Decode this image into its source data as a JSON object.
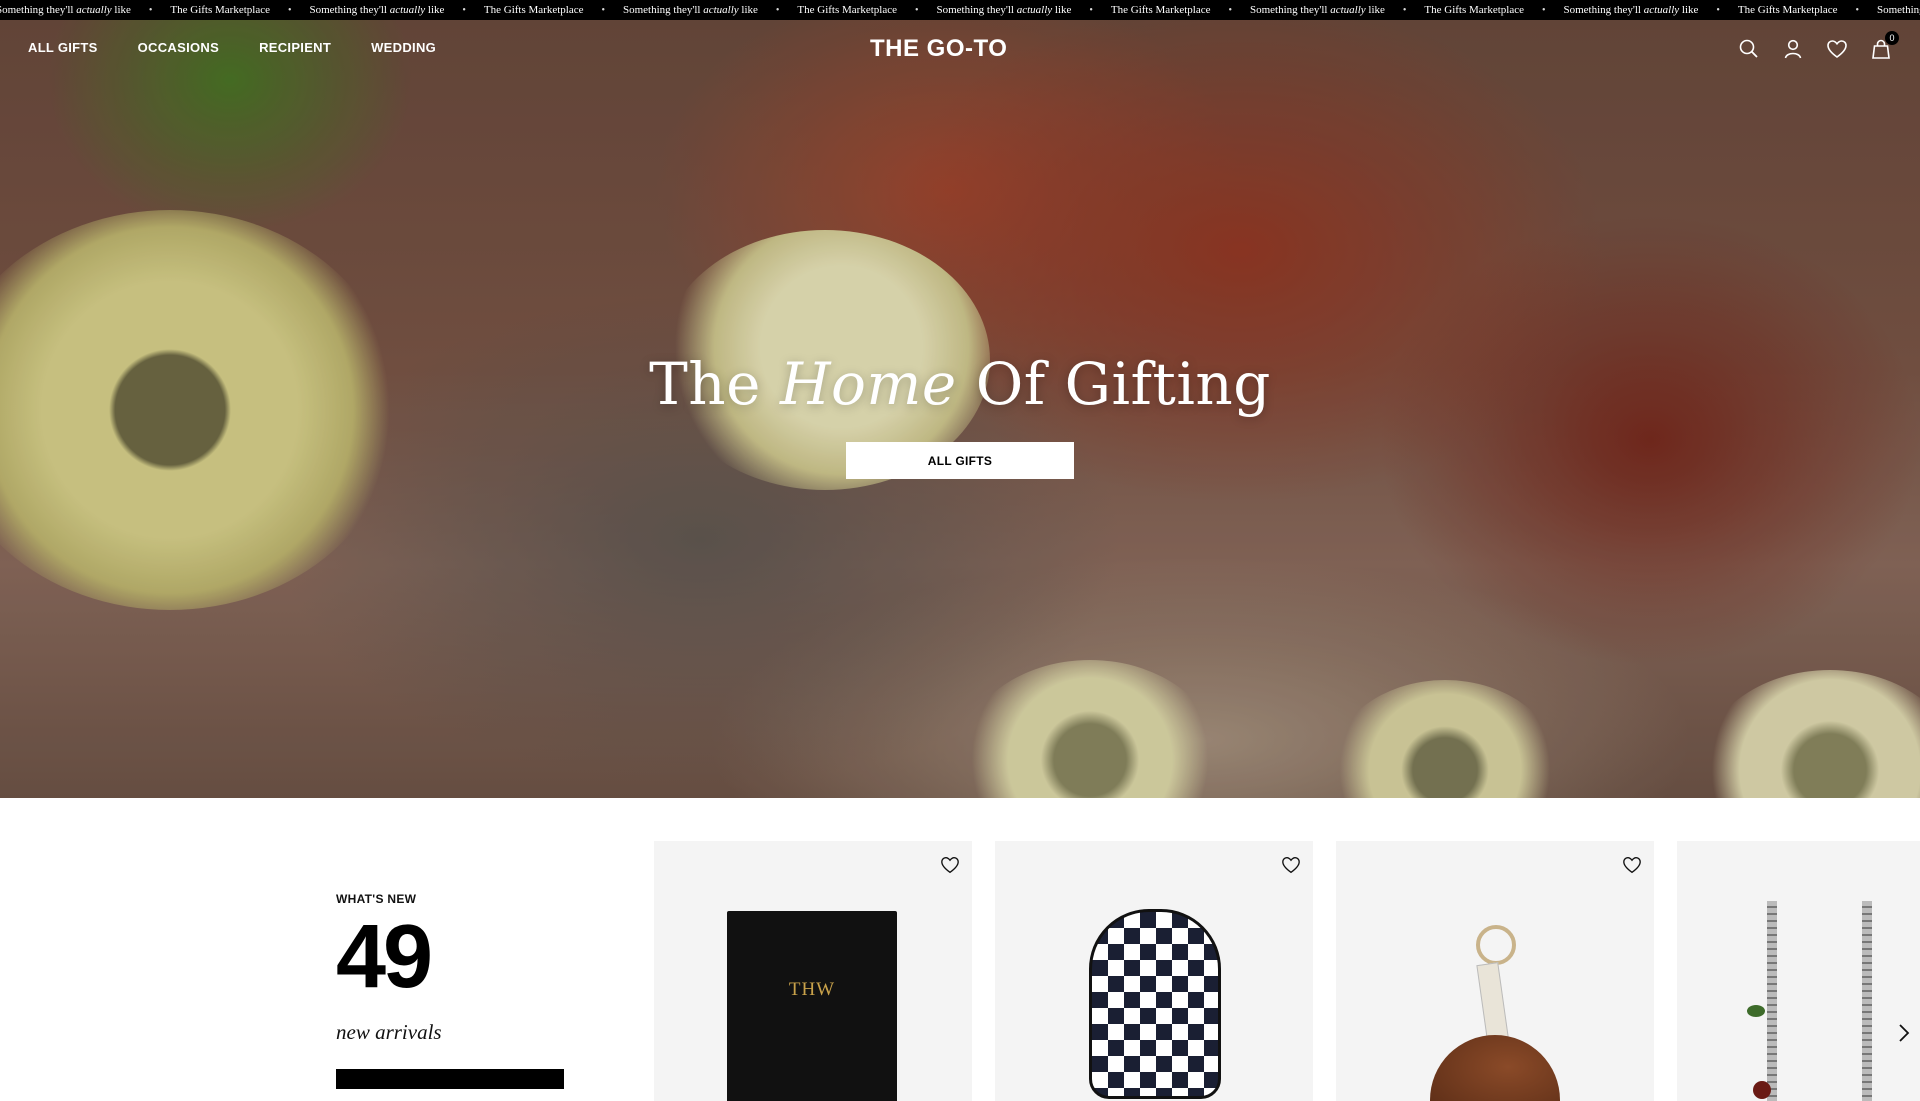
{
  "ticker": {
    "tagline_pre": "Something they'll",
    "tagline_em": "actually",
    "tagline_post": "like",
    "brand_line": "The Gifts Marketplace",
    "separator": "•"
  },
  "header": {
    "nav": [
      "ALL GIFTS",
      "OCCASIONS",
      "RECIPIENT",
      "WEDDING"
    ],
    "logo": "THE GO-TO",
    "cart_count": "0"
  },
  "hero": {
    "title_pre": "The",
    "title_em": "Home",
    "title_post": "Of Gifting",
    "button": "ALL GIFTS"
  },
  "whats_new": {
    "label": "WHAT'S NEW",
    "count": "49",
    "subtitle": "new arrivals"
  },
  "products": [
    {
      "image": "notebook",
      "monogram": "THW"
    },
    {
      "image": "checkered-paddle-cover"
    },
    {
      "image": "leather-keychain"
    },
    {
      "image": "cherry-earrings"
    }
  ],
  "icons": {
    "search": "search-icon",
    "account": "user-icon",
    "wishlist": "heart-icon",
    "cart": "bag-icon",
    "carousel_next": "chevron-right-icon"
  }
}
